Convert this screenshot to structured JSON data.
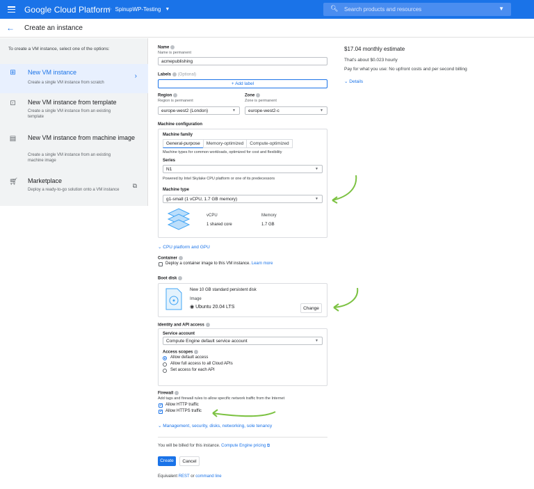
{
  "topbar": {
    "brand": "Google Cloud Platform",
    "project": "SpinupWP-Testing",
    "search_placeholder": "Search products and resources"
  },
  "subheader": {
    "title": "Create an instance"
  },
  "left": {
    "intro": "To create a VM instance, select one of the options:",
    "options": [
      {
        "title": "New VM instance",
        "desc": "Create a single VM instance from scratch",
        "icon": "vm-add-icon"
      },
      {
        "title": "New VM instance from template",
        "desc": "Create a single VM instance from an existing template",
        "icon": "template-icon"
      },
      {
        "title": "New VM instance from machine image",
        "desc": "Create a single VM instance from an existing machine image",
        "icon": "machine-image-icon"
      },
      {
        "title": "Marketplace",
        "desc": "Deploy a ready-to-go solution onto a VM instance",
        "icon": "cart-icon"
      }
    ]
  },
  "form": {
    "name_label": "Name",
    "name_sub": "Name is permanent",
    "name_value": "acmepublishing",
    "labels_label": "Labels",
    "labels_optional": "(Optional)",
    "add_label": "Add label",
    "region_label": "Region",
    "region_sub": "Region is permanent",
    "region_value": "europe-west2 (London)",
    "zone_label": "Zone",
    "zone_sub": "Zone is permanent",
    "zone_value": "europe-west2-c",
    "machine_config_label": "Machine configuration",
    "machine_family_label": "Machine family",
    "family_tabs": [
      "General-purpose",
      "Memory-optimized",
      "Compute-optimized"
    ],
    "family_desc": "Machine types for common workloads, optimized for cost and flexibility",
    "series_label": "Series",
    "series_value": "N1",
    "series_desc": "Powered by Intel Skylake CPU platform or one of its predecessors",
    "machine_type_label": "Machine type",
    "machine_type_value": "g1-small (1 vCPU, 1.7 GB memory)",
    "vcpu_header": "vCPU",
    "vcpu_value": "1 shared core",
    "memory_header": "Memory",
    "memory_value": "1.7 GB",
    "cpu_platform_link": "CPU platform and GPU",
    "container_label": "Container",
    "container_text": "Deploy a container image to this VM instance.",
    "learn_more": "Learn more",
    "boot_disk_label": "Boot disk",
    "boot_disk_desc": "New 10 GB standard persistent disk",
    "image_label": "Image",
    "image_value": "Ubuntu 20.04 LTS",
    "change_button": "Change",
    "identity_label": "Identity and API access",
    "service_account_label": "Service account",
    "service_account_value": "Compute Engine default service account",
    "access_scopes_label": "Access scopes",
    "scope_options": [
      "Allow default access",
      "Allow full access to all Cloud APIs",
      "Set access for each API"
    ],
    "firewall_label": "Firewall",
    "firewall_desc": "Add tags and firewall rules to allow specific network traffic from the Internet",
    "http_label": "Allow HTTP traffic",
    "https_label": "Allow HTTPS traffic",
    "management_link": "Management, security, disks, networking, sole tenancy",
    "billing_text": "You will be billed for this instance.",
    "pricing_link": "Compute Engine pricing",
    "create_button": "Create",
    "cancel_button": "Cancel",
    "equivalent_text": "Equivalent",
    "rest_link": "REST",
    "or_text": "or",
    "cmd_link": "command line"
  },
  "estimate": {
    "title": "$17.04 monthly estimate",
    "hourly": "That's about $0.023 hourly",
    "billing": "Pay for what you use: No upfront costs and per second billing",
    "details": "Details"
  },
  "colors": {
    "primary": "#1a73e8",
    "annotation_arrow": "#7cc242"
  }
}
